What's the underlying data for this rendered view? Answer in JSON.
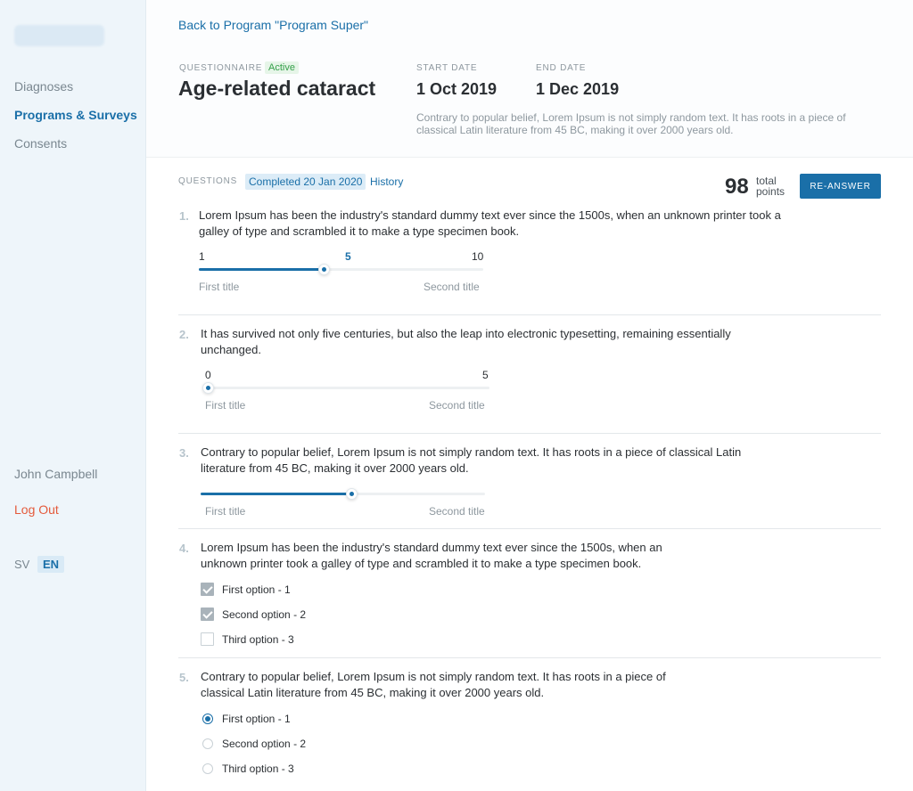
{
  "sidebar": {
    "items": [
      {
        "label": "Diagnoses"
      },
      {
        "label": "Programs & Surveys"
      },
      {
        "label": "Consents"
      }
    ],
    "user_name": "John Campbell",
    "logout_label": "Log Out",
    "languages": [
      "SV",
      "EN"
    ],
    "active_language": "EN"
  },
  "header": {
    "back_link": "Back to Program \"Program Super\"",
    "questionnaire_label": "QUESTIONNAIRE",
    "status": "Active",
    "title": "Age-related cataract",
    "start_label": "START DATE",
    "start_value": "1 Oct 2019",
    "end_label": "END DATE",
    "end_value": "1 Dec 2019",
    "description": "Contrary to popular belief, Lorem Ipsum is not simply random text. It has roots in a piece of classical Latin literature from 45 BC, making it over 2000 years old."
  },
  "questions_header": {
    "label": "QUESTIONS",
    "completed": "Completed 20 Jan 2020",
    "history": "History",
    "points_value": "98",
    "points_line1": "total",
    "points_line2": "points",
    "reanswer_label": "RE-ANSWER"
  },
  "questions": [
    {
      "num": "1.",
      "text": "Lorem Ipsum has been the industry's standard dummy text ever since the 1500s, when an unknown printer took a galley of type and scrambled it to make a type specimen book.",
      "min": "1",
      "current": "5",
      "max": "10",
      "fraction": 0.44,
      "left_title": "First title",
      "right_title": "Second title"
    },
    {
      "num": "2.",
      "text": "It has survived not only five centuries, but also the leap into electronic typesetting, remaining essentially unchanged.",
      "min": "0",
      "max": "5",
      "fraction": 0,
      "left_title": "First title",
      "right_title": "Second title"
    },
    {
      "num": "3.",
      "text": "Contrary to popular belief, Lorem Ipsum is not simply random text. It has roots in a piece of classical Latin literature from 45 BC, making it over 2000 years old.",
      "fraction": 0.53,
      "left_title": "First title",
      "right_title": "Second title"
    },
    {
      "num": "4.",
      "text": "Lorem Ipsum has been the industry's standard dummy text ever since the 1500s, when an unknown printer took a galley of type and scrambled it to make a type specimen book.",
      "options": [
        {
          "label": "First option - 1",
          "checked": true
        },
        {
          "label": "Second option - 2",
          "checked": true
        },
        {
          "label": "Third option - 3",
          "checked": false
        }
      ]
    },
    {
      "num": "5.",
      "text": "Contrary to popular belief, Lorem Ipsum is not simply random text. It has roots in a piece of classical Latin literature from 45 BC, making it over 2000 years old.",
      "options": [
        {
          "label": "First option - 1",
          "checked": true
        },
        {
          "label": "Second option - 2",
          "checked": false
        },
        {
          "label": "Third option - 3",
          "checked": false
        }
      ]
    }
  ],
  "colors": {
    "accent": "#1a6fa8",
    "sidebar_bg": "#eef5fa",
    "logout": "#e45a3b",
    "active_badge": "#35a04a"
  }
}
